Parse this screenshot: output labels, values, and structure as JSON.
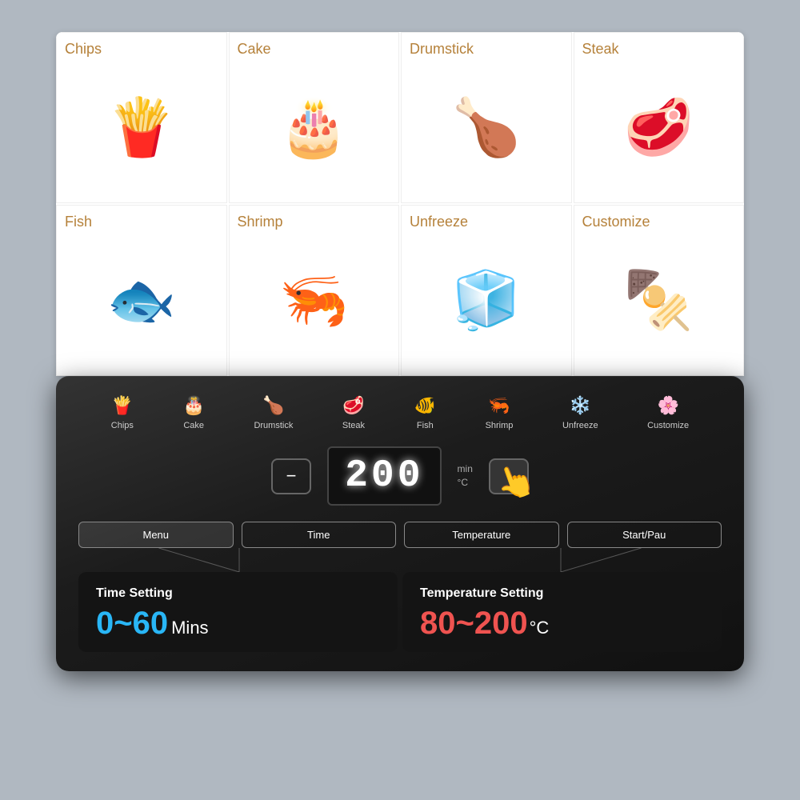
{
  "food_items": [
    {
      "id": "chips",
      "label": "Chips",
      "emoji": "🍟"
    },
    {
      "id": "cake",
      "label": "Cake",
      "emoji": "🎂"
    },
    {
      "id": "drumstick",
      "label": "Drumstick",
      "emoji": "🍗"
    },
    {
      "id": "steak",
      "label": "Steak",
      "emoji": "🥩"
    },
    {
      "id": "fish",
      "label": "Fish",
      "emoji": "🐟"
    },
    {
      "id": "shrimp",
      "label": "Shrimp",
      "emoji": "🦐"
    },
    {
      "id": "unfreeze",
      "label": "Unfreeze",
      "emoji": "🧊"
    },
    {
      "id": "customize",
      "label": "Customize",
      "emoji": "🍢"
    }
  ],
  "preset_icons": [
    {
      "id": "chips",
      "icon": "🍟",
      "label": "Chips"
    },
    {
      "id": "cake",
      "icon": "🎂",
      "label": "Cake"
    },
    {
      "id": "drumstick",
      "icon": "🍗",
      "label": "Drumstick"
    },
    {
      "id": "steak",
      "icon": "🥩",
      "label": "Steak"
    },
    {
      "id": "fish",
      "icon": "🐠",
      "label": "Fish"
    },
    {
      "id": "shrimp",
      "icon": "🦐",
      "label": "Shrimp"
    },
    {
      "id": "unfreeze",
      "icon": "❄️",
      "label": "Unfreeze"
    },
    {
      "id": "customize",
      "icon": "🌸",
      "label": "Customize"
    }
  ],
  "display": {
    "temperature": "200",
    "unit_min": "min",
    "unit_deg": "°C"
  },
  "buttons": {
    "minus": "−",
    "plus": "+",
    "menu": "Menu",
    "time": "Time",
    "temperature": "Temperature",
    "start_pause": "Start/Pau"
  },
  "time_setting": {
    "title": "Time Setting",
    "value": "0~60",
    "suffix": "Mins"
  },
  "temperature_setting": {
    "title": "Temperature Setting",
    "value": "80~200",
    "suffix": "°C"
  }
}
